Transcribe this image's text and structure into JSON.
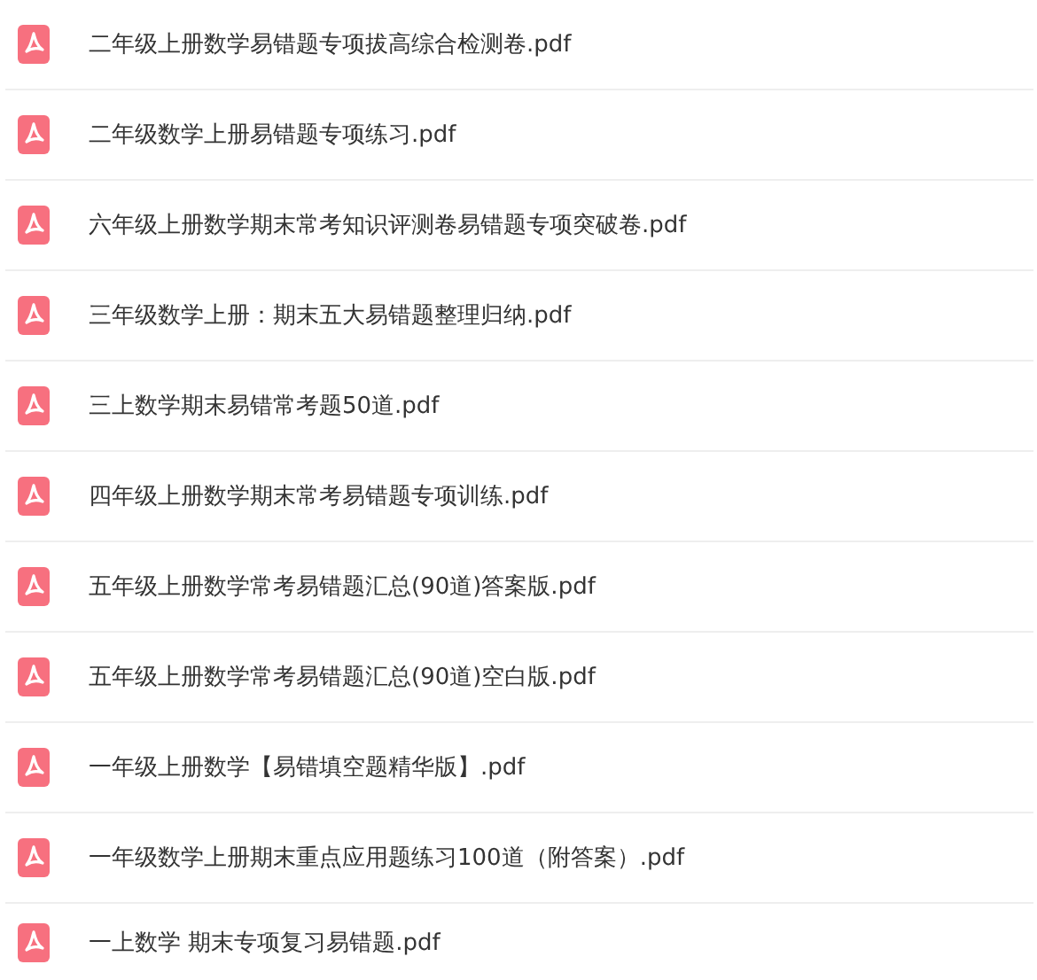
{
  "files": [
    {
      "name": "二年级上册数学易错题专项拔高综合检测卷.pdf"
    },
    {
      "name": "二年级数学上册易错题专项练习.pdf"
    },
    {
      "name": "六年级上册数学期末常考知识评测卷易错题专项突破卷.pdf"
    },
    {
      "name": "三年级数学上册：期末五大易错题整理归纳.pdf"
    },
    {
      "name": "三上数学期末易错常考题50道.pdf"
    },
    {
      "name": "四年级上册数学期末常考易错题专项训练.pdf"
    },
    {
      "name": "五年级上册数学常考易错题汇总(90道)答案版.pdf"
    },
    {
      "name": "五年级上册数学常考易错题汇总(90道)空白版.pdf"
    },
    {
      "name": "一年级上册数学【易错填空题精华版】.pdf"
    },
    {
      "name": "一年级数学上册期末重点应用题练习100道（附答案）.pdf"
    },
    {
      "name": "一上数学 期末专项复习易错题.pdf"
    }
  ]
}
